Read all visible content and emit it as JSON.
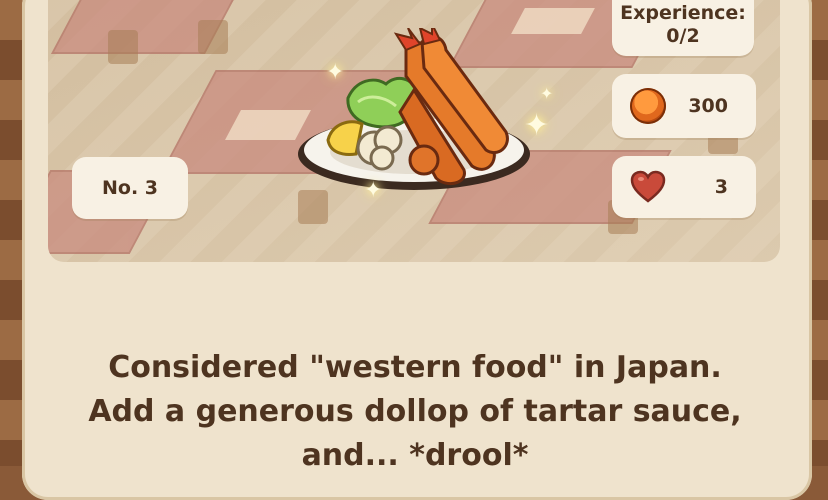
{
  "recipe": {
    "number_label": "No. 3",
    "experience_label": "Experience:",
    "experience_value": "0/2",
    "price": "300",
    "hearts": "3",
    "dish_icon": "fried-shrimp-plate-icon",
    "description_lines": [
      "Considered \"western food\" in Japan.",
      "Add a generous dollop of tartar sauce,",
      "and... *drool*"
    ]
  },
  "colors": {
    "panel": "#efe3cd",
    "text": "#4e3420",
    "coin": "#e0681d",
    "heart": "#c94a3a"
  }
}
